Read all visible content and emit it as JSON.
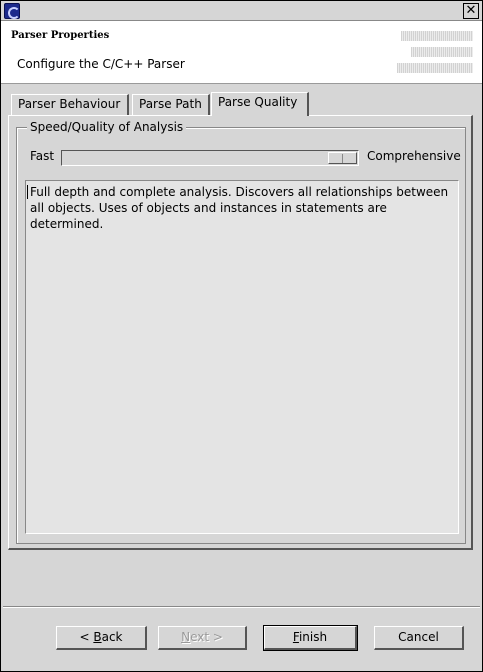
{
  "window": {
    "close_glyph": "✕"
  },
  "banner": {
    "title": "Parser Properties",
    "description": "Configure the C/C++ Parser"
  },
  "tabs": [
    {
      "label": "Parser Behaviour",
      "active": false
    },
    {
      "label": "Parse Path",
      "active": false
    },
    {
      "label": "Parse Quality",
      "active": true
    }
  ],
  "quality": {
    "group_label": "Speed/Quality of Analysis",
    "min_label": "Fast",
    "max_label": "Comprehensive",
    "slider_position_fraction": 1.0,
    "description": "Full depth and complete analysis.  Discovers all relationships between all objects.  Uses of objects and instances in statements are determined."
  },
  "buttons": {
    "back": {
      "prefix": "< ",
      "mnemonic": "B",
      "rest": "ack",
      "enabled": true
    },
    "next": {
      "mnemonic": "N",
      "rest": "ext >",
      "enabled": false
    },
    "finish": {
      "mnemonic": "F",
      "rest": "inish",
      "enabled": true
    },
    "cancel": {
      "label": "Cancel",
      "enabled": true
    }
  },
  "colors": {
    "dialog_bg": "#d6d6d6",
    "banner_bg": "#ffffff",
    "disabled_text": "#9a9a9a"
  }
}
